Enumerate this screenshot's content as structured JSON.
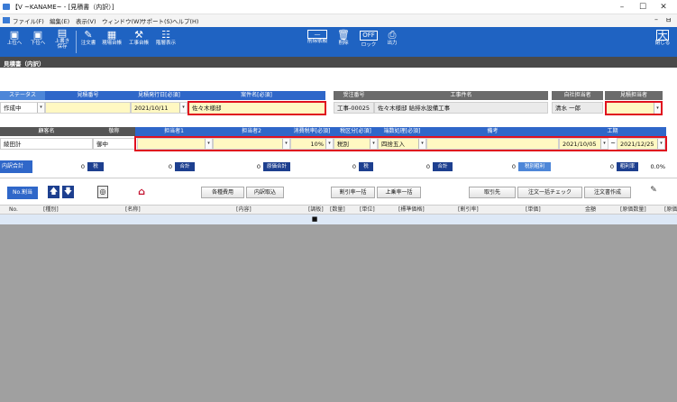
{
  "window": {
    "title": "【V ~KANAME~ - [見積書（内訳）]",
    "min": "–",
    "max": "☐",
    "close": "✕",
    "mdi_min": "–",
    "mdi_restore": "ㅂ"
  },
  "menu": [
    "ファイル(F)",
    "編集(E)",
    "表示(V)",
    "ウィンドウ(W)",
    "サポート(S)",
    "ヘルプ(H)"
  ],
  "toolbar": {
    "left": [
      {
        "label": "上位へ",
        "icon": "up-level-icon"
      },
      {
        "label": "下位へ",
        "icon": "down-level-icon"
      },
      {
        "label": "上書き\n保存",
        "icon": "save-icon"
      },
      {
        "label": "注文書",
        "icon": "order-icon"
      },
      {
        "label": "現場台帳",
        "icon": "site-ledger-icon"
      },
      {
        "label": "工事台帳",
        "icon": "work-ledger-icon"
      },
      {
        "label": "階層表示",
        "icon": "tree-icon"
      }
    ],
    "right": [
      {
        "label": "削除依頼",
        "icon": "delete-request-icon"
      },
      {
        "label": "削除",
        "icon": "trash-icon"
      },
      {
        "label": "ロック",
        "icon": "lock-off-icon",
        "badge": "OFF"
      },
      {
        "label": "出力",
        "icon": "print-icon"
      }
    ],
    "close": {
      "label": "閉じる",
      "icon": "close-door-icon"
    }
  },
  "section_title": "見積書（内訳）",
  "row1": {
    "headers": [
      "ステータス",
      "見積番号",
      "見積発行日[必須]",
      "案件名[必須]",
      "受注番号",
      "工事件名",
      "自社担当者",
      "見積担当者"
    ],
    "status": "作成中",
    "est_no": "",
    "issue_date": "2021/10/11",
    "project": "佐々木様邸",
    "order_no": "工事-00025",
    "work_name": "佐々木様邸  給排水設備工事",
    "own_staff": "清水  一郎",
    "est_staff": ""
  },
  "row2": {
    "headers": [
      "顧客名",
      "敬称",
      "担当者1",
      "担当者2",
      "消費税率[必須]",
      "税区分[必須]",
      "端数処理[必須]",
      "備考",
      "工期"
    ],
    "customer": "綾田計",
    "honorific": "御中",
    "staff1": "",
    "staff2": "",
    "tax_rate": "10%",
    "tax_class": "税別",
    "rounding": "四捨五入",
    "note": "",
    "period_from": "2021/10/05",
    "tilde": "~",
    "period_to": "2021/12/25"
  },
  "totals": {
    "items": [
      {
        "label": "内訳合計",
        "value": "0",
        "unit": "税"
      },
      {
        "label": "",
        "value": "0",
        "unit": "合計"
      },
      {
        "label": "",
        "value": "0",
        "unit": "原価合計"
      },
      {
        "label": "",
        "value": "0",
        "unit": "税"
      },
      {
        "label": "",
        "value": "0",
        "unit": "合計"
      },
      {
        "label": "",
        "value": "0",
        "unit": "税別粗利"
      },
      {
        "label": "",
        "value": "0",
        "unit": "粗利率"
      }
    ],
    "rate": "0.0%"
  },
  "actions": {
    "no_renumber": "No.割当",
    "arrow_up": "🡅",
    "arrow_down": "🡇",
    "buttons": [
      "各種費用",
      "内訳取込",
      "割引率一括",
      "上乗率一括",
      "取引先",
      "注文一括チェック",
      "注文書作成"
    ]
  },
  "grid": {
    "headers": [
      "No.",
      "[種別]",
      "[名称]",
      "[内容]",
      "[調板]",
      "[数量]",
      "[単位]",
      "[標準価格]",
      "[割引率]",
      "[単価]",
      "金額",
      "[原価数量]",
      "[原価"
    ],
    "checkbox": "■"
  },
  "colors": {
    "toolbar": "#1f63c2",
    "header_blue": "#2f67c9",
    "highlight": "#e0101e",
    "required_bg": "#fff8c2"
  }
}
